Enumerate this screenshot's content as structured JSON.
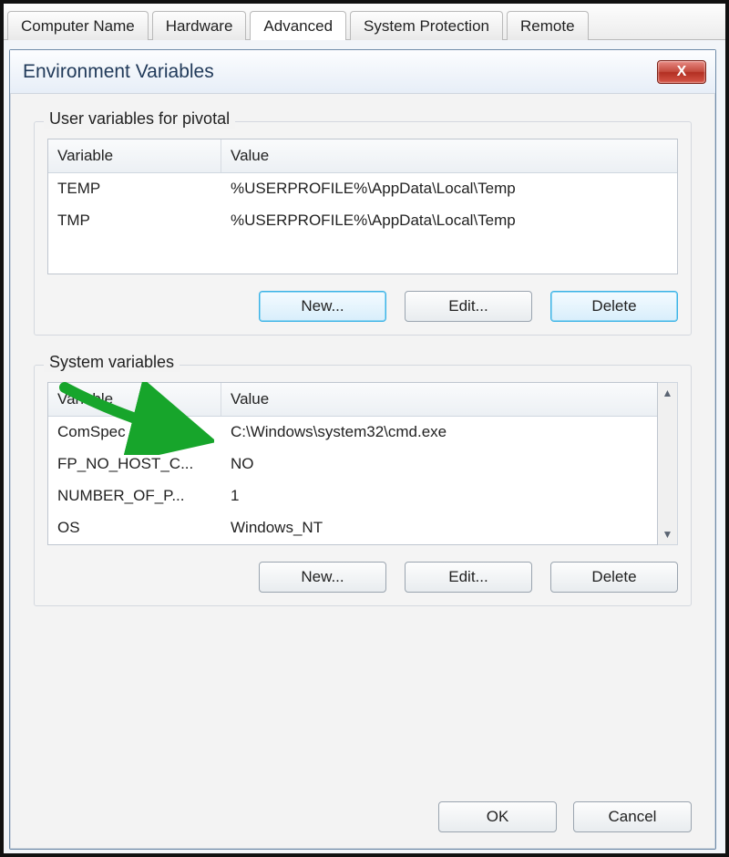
{
  "tabs": {
    "computer_name": "Computer Name",
    "hardware": "Hardware",
    "advanced": "Advanced",
    "system_protection": "System Protection",
    "remote": "Remote"
  },
  "dialog": {
    "title": "Environment Variables",
    "close_glyph": "X"
  },
  "user_group": {
    "legend": "User variables for pivotal",
    "headers": {
      "variable": "Variable",
      "value": "Value"
    },
    "rows": [
      {
        "variable": "TEMP",
        "value": "%USERPROFILE%\\AppData\\Local\\Temp"
      },
      {
        "variable": "TMP",
        "value": "%USERPROFILE%\\AppData\\Local\\Temp"
      }
    ],
    "buttons": {
      "new": "New...",
      "edit": "Edit...",
      "delete": "Delete"
    }
  },
  "system_group": {
    "legend": "System variables",
    "headers": {
      "variable": "Variable",
      "value": "Value"
    },
    "rows": [
      {
        "variable": "ComSpec",
        "value": "C:\\Windows\\system32\\cmd.exe"
      },
      {
        "variable": "FP_NO_HOST_C...",
        "value": "NO"
      },
      {
        "variable": "NUMBER_OF_P...",
        "value": "1"
      },
      {
        "variable": "OS",
        "value": "Windows_NT"
      }
    ],
    "buttons": {
      "new": "New...",
      "edit": "Edit...",
      "delete": "Delete"
    }
  },
  "footer": {
    "ok": "OK",
    "cancel": "Cancel"
  },
  "scroll": {
    "up": "▲",
    "down": "▼"
  }
}
